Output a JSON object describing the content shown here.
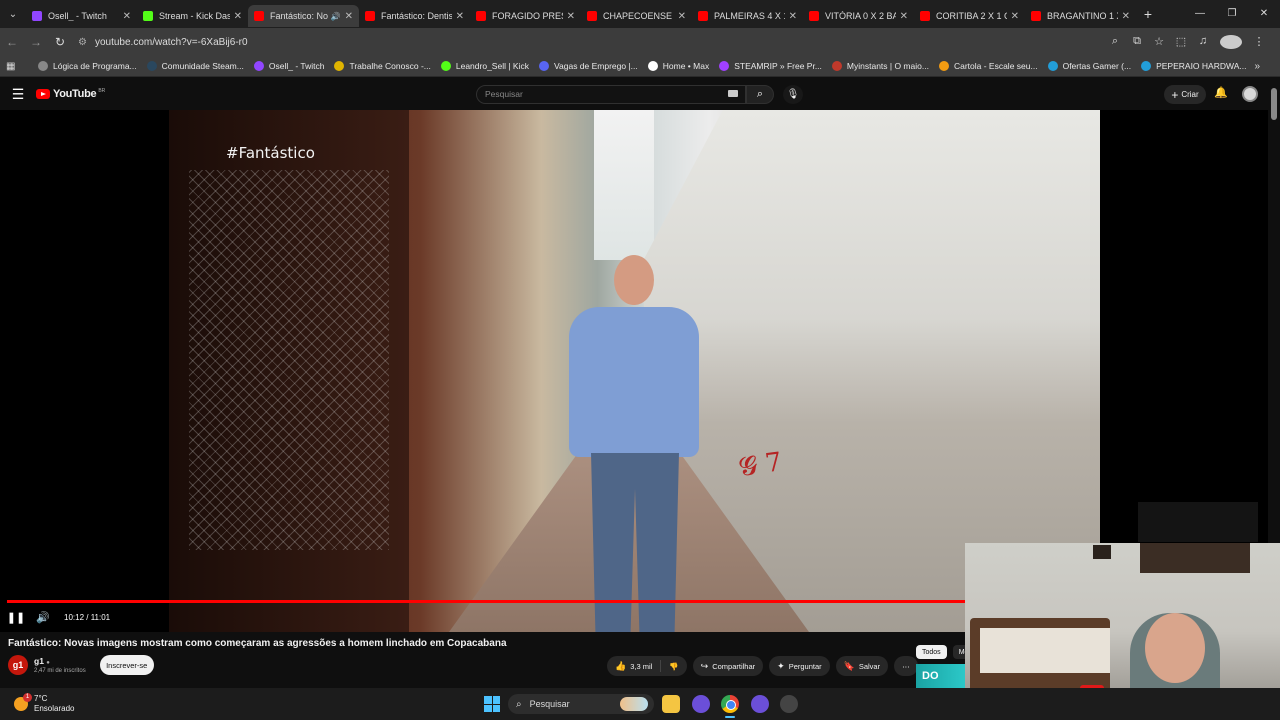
{
  "browser": {
    "tabs": [
      {
        "title": "Osell_ - Twitch",
        "color": "#9146ff",
        "active": false
      },
      {
        "title": "Stream - Kick Das",
        "color": "#53fc18",
        "active": false
      },
      {
        "title": "Fantástico: No",
        "color": "#ff0000",
        "active": true,
        "audio": true
      },
      {
        "title": "Fantástico: Dentis",
        "color": "#ff0000",
        "active": false
      },
      {
        "title": "FORAGIDO PRESO",
        "color": "#ff0000",
        "active": false
      },
      {
        "title": "CHAPECOENSE 1",
        "color": "#ff0000",
        "active": false
      },
      {
        "title": "PALMEIRAS 4 X 1",
        "color": "#ff0000",
        "active": false
      },
      {
        "title": "VITÓRIA 0 X 2 BA",
        "color": "#ff0000",
        "active": false
      },
      {
        "title": "CORITIBA 2 X 1 C",
        "color": "#ff0000",
        "active": false
      },
      {
        "title": "BRAGANTINO 1 X",
        "color": "#ff0000",
        "active": false
      }
    ],
    "url": "youtube.com/watch?v=-6XaBij6-r0",
    "bookmarks": [
      {
        "label": "Lógica de Programa...",
        "color": "#888"
      },
      {
        "label": "Comunidade Steam...",
        "color": "#2a475e"
      },
      {
        "label": "Osell_ - Twitch",
        "color": "#9146ff"
      },
      {
        "label": "Trabalhe Conosco -...",
        "color": "#e0b400"
      },
      {
        "label": "Leandro_Sell | Kick",
        "color": "#53fc18"
      },
      {
        "label": "Vagas de Emprego |...",
        "color": "#5865f2"
      },
      {
        "label": "Home • Max",
        "color": "#ffffff"
      },
      {
        "label": "STEAMRIP » Free Pr...",
        "color": "#a040ff"
      },
      {
        "label": "Myinstants | O maio...",
        "color": "#c0392b"
      },
      {
        "label": "Cartola - Escale seu...",
        "color": "#f39c12"
      },
      {
        "label": "Ofertas Gamer (...",
        "color": "#229ed9"
      },
      {
        "label": "PEPERAIO HARDWA...",
        "color": "#229ed9"
      }
    ]
  },
  "youtube": {
    "logo_text": "YouTube",
    "region": "BR",
    "search_placeholder": "Pesquisar",
    "create_label": "Criar",
    "video_overlay": "#Fantástico",
    "timecode": "10:12 / 11:01",
    "progress_fraction": 0.926,
    "video_title": "Fantástico: Novas imagens mostram como começaram as agressões a homem linchado em Copacabana",
    "channel": {
      "logo": "g1",
      "name": "g1",
      "subscribers": "2,47 mi de inscritos"
    },
    "subscribe_label": "Inscrever-se",
    "likes": "3,3 mil",
    "share_label": "Compartilhar",
    "ask_label": "Perguntar",
    "save_label": "Salvar",
    "chips": [
      "Todos",
      "Me"
    ],
    "thumb_text": "DO"
  },
  "taskbar": {
    "temperature": "7°C",
    "weather": "Ensolarado",
    "search_label": "Pesquisar"
  }
}
